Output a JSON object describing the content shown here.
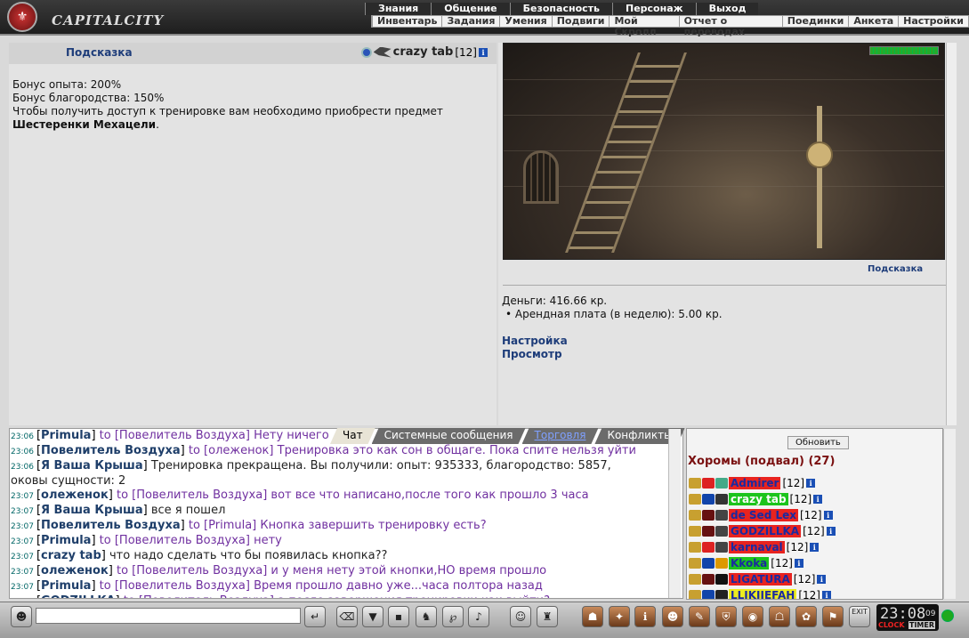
{
  "header": {
    "brand": "CAPITALCITY",
    "logo_symbol": "⚜",
    "menu_top": [
      "Знания",
      "Общение",
      "Безопасность",
      "Персонаж",
      "Выход"
    ],
    "menu_sub": [
      "Инвентарь",
      "Задания",
      "Умения",
      "Подвиги",
      "Мой Скролл",
      "Отчет о переводах",
      "Поединки",
      "Анкета",
      "Настройки"
    ]
  },
  "left": {
    "hint_link": "Подсказка",
    "user": {
      "name": "crazy tab",
      "level": "[12]",
      "info": "i"
    },
    "lines": [
      "Бонус опыта: 200%",
      "Бонус благородства: 150%",
      "Чтобы получить доступ к тренировке вам необходимо приобрести предмет"
    ],
    "item": "Шестеренки Мехацели",
    "item_tail": "."
  },
  "right": {
    "scene_hint": "Подсказка",
    "money": "Деньги: 416.66 кр.",
    "rent": "• Арендная плата (в неделю): 5.00 кр.",
    "settings_link": "Настройка",
    "view_link": "Просмотр",
    "hp_fraction": 1.0
  },
  "chat": {
    "tabs": [
      "Чат",
      "Системные сообщения",
      "Торговля",
      "Конфликты"
    ],
    "lines": [
      {
        "t": "23:06",
        "from": "Primula",
        "to": "to [Повелитель Воздуха]",
        "msg": "Нету ничего",
        "c": "pr"
      },
      {
        "t": "23:06",
        "from": "Повелитель Воздуха",
        "to": "to [олеженок]",
        "msg": "Тренировка это как сон в общаге. Пока спите нельзя уйти",
        "c": "pr"
      },
      {
        "t": "23:06",
        "from": "Я Ваша Крыша",
        "to": "",
        "msg": "Тренировка прекращена. Вы получили: опыт: 935333, благородство: 5857,",
        "c": "bl"
      },
      {
        "t": "",
        "from": "",
        "to": "",
        "msg": "оковы сущности: 2",
        "c": "bl"
      },
      {
        "t": "23:07",
        "from": "олеженок",
        "to": "to [Повелитель Воздуха]",
        "msg": "вот все что написано,после того как прошло 3 часа",
        "c": "pr"
      },
      {
        "t": "23:07",
        "from": "Я Ваша Крыша",
        "to": "",
        "msg": "все я пошел",
        "c": "bl"
      },
      {
        "t": "23:07",
        "from": "Повелитель Воздуха",
        "to": "to [Primula]",
        "msg": "Кнопка завершить тренировку есть?",
        "c": "pr"
      },
      {
        "t": "23:07",
        "from": "Primula",
        "to": "to [Повелитель Воздуха]",
        "msg": "нету",
        "c": "pr"
      },
      {
        "t": "23:07",
        "from": "crazy tab",
        "to": "",
        "msg": "что надо сделать что бы появилась кнопка??",
        "c": "bl"
      },
      {
        "t": "23:07",
        "from": "олеженок",
        "to": "to [Повелитель Воздуха]",
        "msg": "и у меня нету этой кнопки,НО время прошло",
        "c": "pr"
      },
      {
        "t": "23:07",
        "from": "Primula",
        "to": "to [Повелитель Воздуха]",
        "msg": "Время прошло давно уже...часа полтора назад",
        "c": "pr"
      },
      {
        "t": "23:07",
        "from": "GODZILLKA",
        "to": "to [Повелитель Воздуха]",
        "msg": "а после завершения тренировки как выйти?",
        "c": "pr"
      }
    ]
  },
  "roster": {
    "refresh": "Обновить",
    "room": "Хоромы (подвал) (27)",
    "players": [
      {
        "name": "Admirer",
        "level": "[12]",
        "bg": "#e8231f",
        "fg": "#1a2aa0"
      },
      {
        "name": "crazy tab",
        "level": "[12]",
        "bg": "#1cc41c",
        "fg": "#ffffff"
      },
      {
        "name": "de Sed Lex",
        "level": "[12]",
        "bg": "#e8231f",
        "fg": "#1a2aa0"
      },
      {
        "name": "GODZILLKA",
        "level": "[12]",
        "bg": "#e8231f",
        "fg": "#1a2aa0"
      },
      {
        "name": "karnaval",
        "level": "[12]",
        "bg": "#e8231f",
        "fg": "#1a2aa0"
      },
      {
        "name": "Kkoka",
        "level": "[12]",
        "bg": "#1cc41c",
        "fg": "#1a2aa0"
      },
      {
        "name": "LIGATURA",
        "level": "[12]",
        "bg": "#e8231f",
        "fg": "#1a2aa0"
      },
      {
        "name": "LLIKJIEFAH",
        "level": "[12]",
        "bg": "#ecec20",
        "fg": "#1a2aa0"
      }
    ]
  },
  "bottom": {
    "clock": "23:08",
    "seconds": "09",
    "clock_label": "CLOCK",
    "timer_label": "TIMER",
    "exit": "EXIT"
  }
}
